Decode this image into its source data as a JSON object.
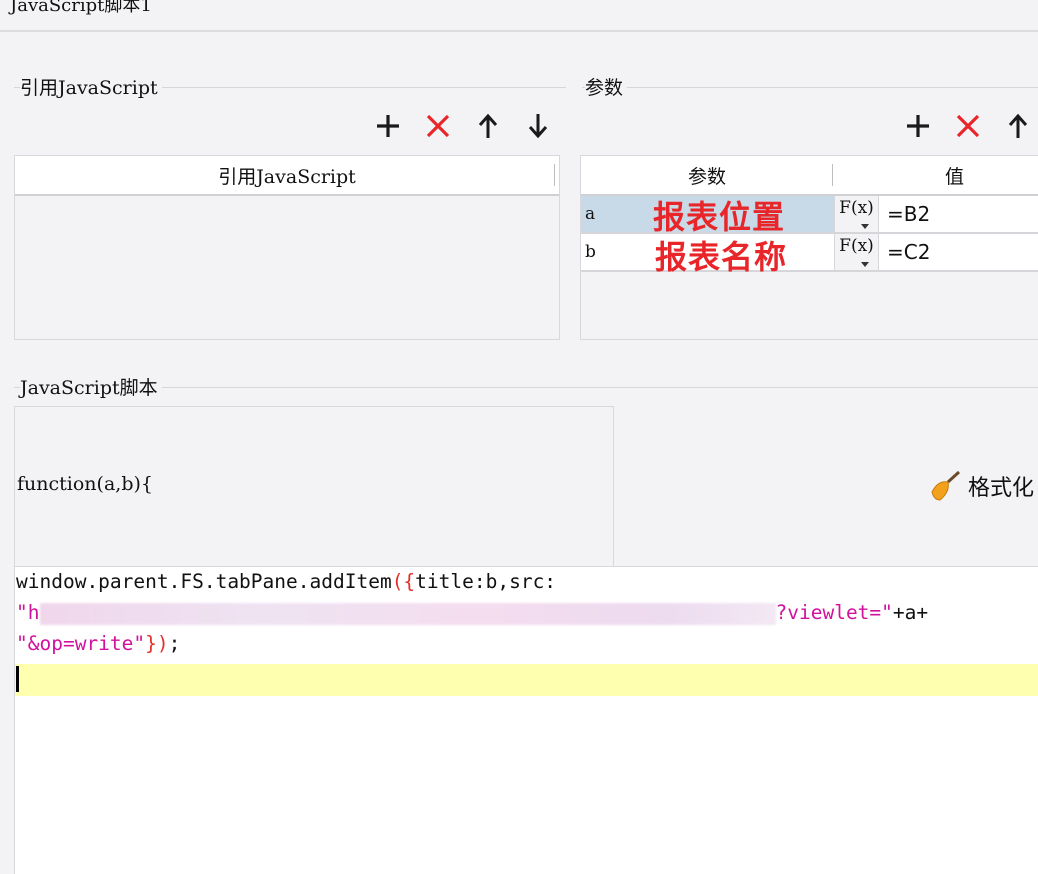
{
  "window": {
    "title": "JavaScript脚本1"
  },
  "ref_section": {
    "label": "引用JavaScript",
    "toolbar": {
      "add_icon": "plus-icon",
      "delete_icon": "x-icon",
      "up_icon": "arrow-up-icon",
      "down_icon": "arrow-down-icon"
    },
    "column_header": "引用JavaScript"
  },
  "params_section": {
    "label": "参数",
    "toolbar": {
      "add_icon": "plus-icon",
      "delete_icon": "x-icon",
      "up_icon": "arrow-up-icon"
    },
    "columns": [
      "参数",
      "值"
    ],
    "rows": [
      {
        "name": "a",
        "annotation": "报表位置",
        "fx_label": "F(x)",
        "value": "=B2",
        "selected": true
      },
      {
        "name": "b",
        "annotation": "报表名称",
        "fx_label": "F(x)",
        "value": "=C2",
        "selected": false
      }
    ]
  },
  "script_section": {
    "label": "JavaScript脚本",
    "function_signature": "function(a,b){",
    "format_button": "格式化",
    "code": {
      "line1_prefix": "window.parent.FS.tabPane.addItem",
      "line1_open": "({",
      "line1_rest": "title:b,src:",
      "line2_quote": "\"",
      "line2_partial": "h",
      "line2_str": "?viewlet=\"",
      "line2_rest": "+a+",
      "line3_str": "\"&op=write\"",
      "line3_close": "})",
      "line3_end": ";"
    }
  },
  "colors": {
    "accent_red": "#e8262a",
    "selected_row": "#c8d9e8",
    "current_line": "#ffffb0",
    "string": "#d0129e"
  }
}
